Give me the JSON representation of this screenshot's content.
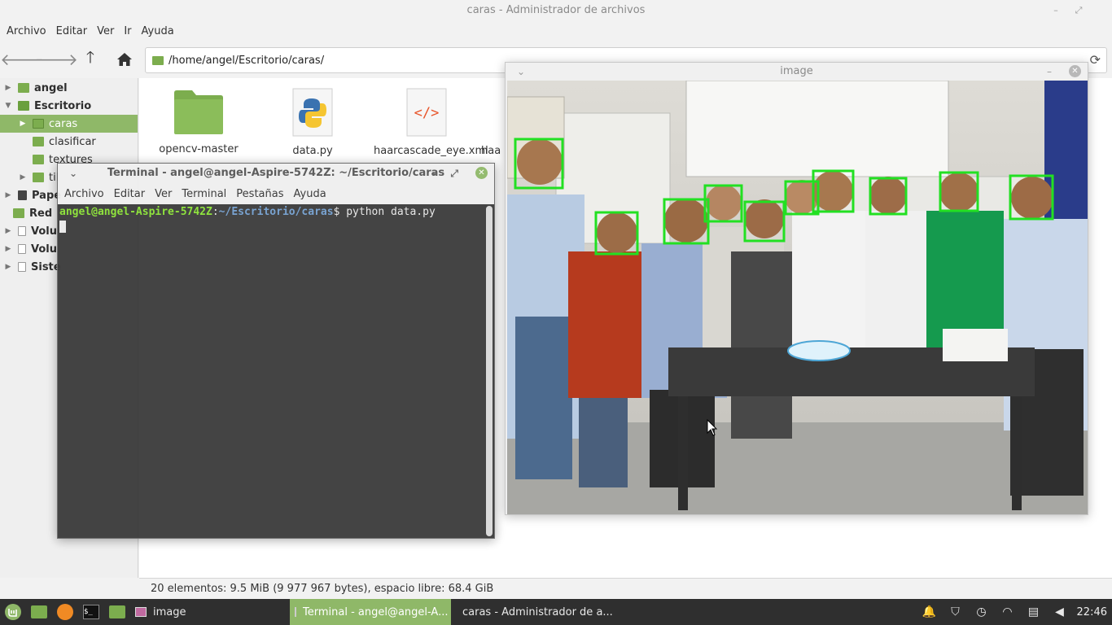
{
  "file_manager": {
    "title": "caras - Administrador de archivos",
    "menu": [
      "Archivo",
      "Editar",
      "Ver",
      "Ir",
      "Ayuda"
    ],
    "location": "/home/angel/Escritorio/caras/",
    "sidebar": [
      {
        "label": "angel",
        "icon": "home-folder-icon",
        "bold": true,
        "arrow": "right"
      },
      {
        "label": "Escritorio",
        "icon": "desktop-folder-icon",
        "bold": true,
        "arrow": "down"
      },
      {
        "label": "caras",
        "icon": "folder-icon",
        "selected": true,
        "arrow": "right"
      },
      {
        "label": "clasificar",
        "icon": "folder-icon"
      },
      {
        "label": "textures",
        "icon": "folder-icon"
      },
      {
        "label": "til",
        "icon": "folder-icon",
        "arrow": "right"
      },
      {
        "label": "Pape",
        "icon": "trash-icon",
        "bold": true,
        "arrow": "right"
      },
      {
        "label": "Red",
        "icon": "network-icon",
        "bold": true
      },
      {
        "label": "Volu",
        "icon": "drive-icon",
        "bold": true,
        "arrow": "right"
      },
      {
        "label": "Volu",
        "icon": "drive-icon",
        "bold": true,
        "arrow": "right"
      },
      {
        "label": "Siste",
        "icon": "filesystem-icon",
        "bold": true,
        "arrow": "right"
      }
    ],
    "files": [
      {
        "name": "opencv-master",
        "icon": "folder-icon"
      },
      {
        "name": "data.py",
        "icon": "python-file-icon"
      },
      {
        "name": "haarcascade_eye.xml",
        "icon": "xml-file-icon"
      },
      {
        "name": "haa",
        "icon": "file-icon"
      }
    ],
    "status": "20 elementos: 9.5 MiB (9 977 967 bytes), espacio libre: 68.4 GiB"
  },
  "terminal": {
    "title": "Terminal - angel@angel-Aspire-5742Z: ~/Escritorio/caras",
    "menu": [
      "Archivo",
      "Editar",
      "Ver",
      "Terminal",
      "Pestañas",
      "Ayuda"
    ],
    "prompt_user": "angel@angel-Aspire-5742Z",
    "prompt_sep": ":",
    "prompt_path": "~/Escritorio/caras",
    "prompt_end": "$ ",
    "command": "python data.py"
  },
  "image_window": {
    "title": "image",
    "detection_color": "#22e022"
  },
  "taskbar": {
    "windows": [
      {
        "label": "image",
        "icon": "image-icon",
        "active": false
      },
      {
        "label": "Terminal - angel@angel-A...",
        "icon": "terminal-icon",
        "active": true
      },
      {
        "label": "caras - Administrador de a...",
        "icon": "folder-icon",
        "active": false
      }
    ],
    "clock": "22:46",
    "accent": "#8fb868"
  }
}
